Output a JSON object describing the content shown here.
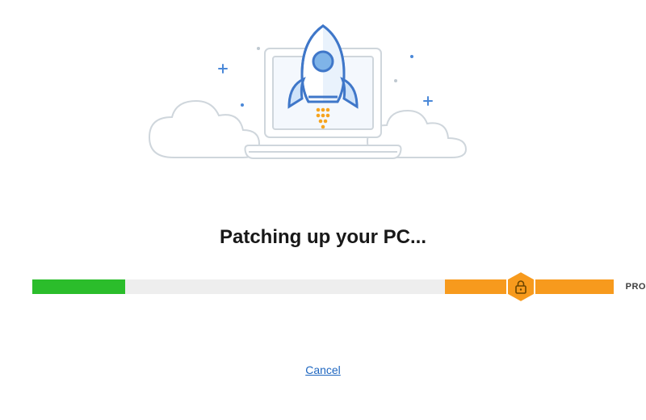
{
  "heading": "Patching up your PC...",
  "progress": {
    "green_percent": 16,
    "orange_percent": 29,
    "lock_position_percent": 84,
    "pro_label": "PRO"
  },
  "cancel_label": "Cancel",
  "icons": {
    "lock": "lock-icon",
    "rocket": "rocket-icon"
  },
  "colors": {
    "green": "#2bbd2b",
    "orange": "#f79a1d",
    "track": "#eeeeee",
    "link": "#1e66c0"
  }
}
